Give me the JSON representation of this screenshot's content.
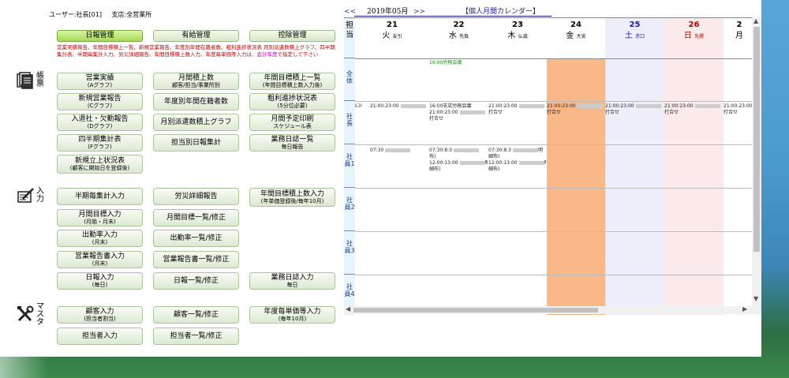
{
  "user_info": {
    "user": "ユーザー:社長[01]",
    "branch": "支店:全営業所"
  },
  "tabs": [
    "日報管理",
    "有給管理",
    "控除管理"
  ],
  "notice": {
    "text": "営業実績報告、年間目標積上一覧、新規営業報告、年度別年間在籍者数、粗利進捗状況表 月別派遣数積上グラフ、四半期集計表、半期毎集計入力、労災詳細報告、年間目標積上数入力、年度毎単価等入力は、",
    "link": "会計年度",
    "text2": "で指定して下さい"
  },
  "sections": {
    "reports": "帳票",
    "input": "入力",
    "master": "マスタ"
  },
  "icons": {
    "reports": "document-stack-icon",
    "input": "pencil-pad-icon",
    "master": "tools-icon"
  },
  "buttons": {
    "sales_results": {
      "label": "営業実績",
      "sub": "(Aグラフ)"
    },
    "monthly_accum": {
      "label": "月間積上数",
      "sub": "顧客/担当/事業所別"
    },
    "annual_goal_list": {
      "label": "年間目標積上一覧",
      "sub": "(年間目標積上数入力後)"
    },
    "new_sales_report": {
      "label": "新規営業報告",
      "sub": "(Cグラフ)"
    },
    "annual_staff": {
      "label": "年度別年間在籍者数",
      "sub": ""
    },
    "gross_profit": {
      "label": "粗利進捗状況表",
      "sub": "(5分位必要)"
    },
    "join_leave": {
      "label": "入退社・欠勤報告",
      "sub": "(Dグラフ)"
    },
    "monthly_dispatch": {
      "label": "月別派遣数積上グラフ",
      "sub": ""
    },
    "monthly_plan": {
      "label": "月間予定印刷",
      "sub": "スケジュール表"
    },
    "quarterly": {
      "label": "四半期集計表",
      "sub": "(Fグラフ)"
    },
    "staff_daily_report": {
      "label": "担当別日報集計",
      "sub": ""
    },
    "work_log_list": {
      "label": "業務日誌一覧",
      "sub": "毎日報告"
    },
    "new_listing": {
      "label": "新規立上状況表",
      "sub": "(顧客に開始日を登録後)"
    },
    "half_year_input": {
      "label": "半期毎集計入力",
      "sub": ""
    },
    "accident_detail": {
      "label": "労災詳細報告",
      "sub": ""
    },
    "annual_goal_input": {
      "label": "年間目標積上数入力",
      "sub": "(年単価登録後/毎年10月)"
    },
    "monthly_goal_input": {
      "label": "月間目標入力",
      "sub": "(月始・月末)"
    },
    "monthly_goal_list": {
      "label": "月間目標一覧/修正",
      "sub": ""
    },
    "attendance_input": {
      "label": "出勤率入力",
      "sub": "(月末)"
    },
    "attendance_list": {
      "label": "出勤率一覧/修正",
      "sub": ""
    },
    "sales_report_input": {
      "label": "営業報告書入力",
      "sub": "(月末)"
    },
    "sales_report_list": {
      "label": "営業報告書一覧/修正",
      "sub": ""
    },
    "daily_input": {
      "label": "日報入力",
      "sub": "(毎日)"
    },
    "daily_list": {
      "label": "日報一覧/修正",
      "sub": ""
    },
    "work_log_input": {
      "label": "業務日誌入力",
      "sub": "毎日"
    },
    "customer_input": {
      "label": "顧客入力",
      "sub": "(担当者割当)"
    },
    "customer_list": {
      "label": "顧客一覧/修正",
      "sub": ""
    },
    "annual_unit_price": {
      "label": "年度毎単価等入力",
      "sub": "(毎年10月)"
    },
    "staff_input": {
      "label": "担当者入力",
      "sub": ""
    },
    "staff_list": {
      "label": "担当者一覧/修正",
      "sub": ""
    }
  },
  "calendar": {
    "prev": "<<",
    "month": "2019年05月",
    "next": ">>",
    "title": "【個人月間カレンダー】",
    "side_header": "担当",
    "rows": [
      "全体",
      "社長",
      "社員1",
      "社員2",
      "社員3",
      "社員4"
    ],
    "days": [
      {
        "d": "21",
        "w": "火",
        "r": "友引",
        "color": "#000000",
        "bg": "#ffffff"
      },
      {
        "d": "22",
        "w": "水",
        "r": "先負",
        "color": "#000000",
        "bg": "#ffffff"
      },
      {
        "d": "23",
        "w": "木",
        "r": "仏滅",
        "color": "#000000",
        "bg": "#ffffff"
      },
      {
        "d": "24",
        "w": "金",
        "r": "大安",
        "color": "#000000",
        "bg": "#f8b888"
      },
      {
        "d": "25",
        "w": "土",
        "r": "赤口",
        "color": "#1a1ab0",
        "bg": "#eeeefb"
      },
      {
        "d": "26",
        "w": "日",
        "r": "先勝",
        "color": "#c00000",
        "bg": "#fbeaea"
      },
      {
        "d": "2",
        "w": "月",
        "r": "",
        "color": "#000000",
        "bg": "#ffffff"
      }
    ],
    "events": {
      "global_meeting": "16:00労務会議",
      "prefix_fragment": "ﾙｺﾄ",
      "presence": "21:00:23:00",
      "presence_tail": "打合せ",
      "branch_meeting": "16:00支店労務会議",
      "e1_a": "07:30",
      "e2_a": "07:30:8:3",
      "e2_b": "布)",
      "e2_c": "12:00:13:00",
      "e2_d": "明",
      "e2_e": "細布)",
      "e3_a": "07:30:8:3",
      "e3_b": "明",
      "e3_c": "細布)",
      "e3_d": "12:00:13:00",
      "e3_e": "明細",
      "e3_f": "細布)"
    }
  }
}
